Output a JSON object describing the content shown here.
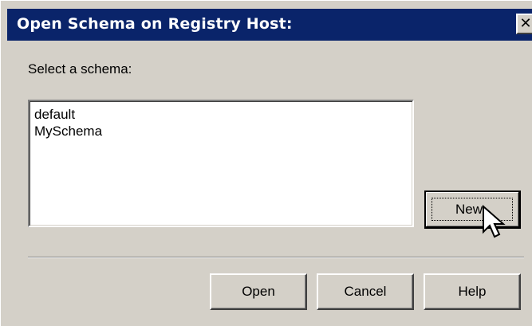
{
  "dialog": {
    "title": "Open Schema on Registry Host:",
    "close_icon": "close-icon",
    "close_glyph": "✕",
    "prompt": "Select a schema:",
    "schemas": [
      "default",
      "MySchema"
    ],
    "buttons": {
      "new": "New",
      "open": "Open",
      "cancel": "Cancel",
      "help": "Help"
    }
  },
  "colors": {
    "titlebar": "#0a246a",
    "window": "#d4d0c8",
    "list_background": "#ffffff"
  }
}
